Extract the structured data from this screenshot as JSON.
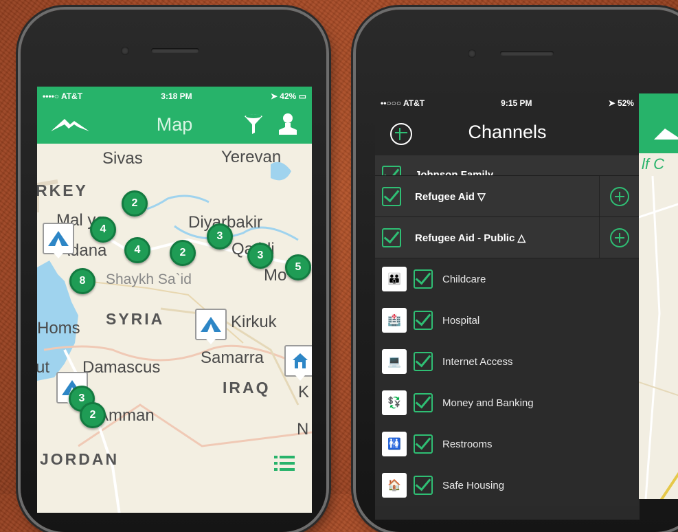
{
  "left_phone": {
    "status": {
      "carrier": "••••○ AT&T",
      "time": "3:18 PM",
      "battery": "42%"
    },
    "nav": {
      "title": "Map"
    },
    "map": {
      "labels": {
        "sivas": "Sivas",
        "yerevan": "Yerevan",
        "turkey": "RKEY",
        "malatya": "Mal   ya",
        "diyarbakir": "Diyarbakir",
        "adana": "Adana",
        "qamishli": "Qa   hli",
        "mosul": "Mo",
        "shaykh": "Shaykh Sa`id",
        "homs": "Homs",
        "syria": "SYRIA",
        "kirkuk": "Kirkuk",
        "samarra": "Samarra",
        "damascus": "Damascus",
        "iraq": "IRAQ",
        "k": "K",
        "amman": "Amman",
        "n": "N",
        "jordan": "JORDAN",
        "ut": "ut"
      },
      "clusters": [
        "2",
        "4",
        "4",
        "2",
        "3",
        "3",
        "5",
        "8",
        "3",
        "2"
      ]
    }
  },
  "right_phone": {
    "status": {
      "carrier": "••○○○ AT&T",
      "time": "9:15 PM",
      "battery": "52%"
    },
    "nav": {
      "title": "Channels"
    },
    "partial_channel": "Johnson Family",
    "channels": [
      {
        "name": "Refugee Aid",
        "arrow": "▽"
      },
      {
        "name": "Refugee Aid - Public",
        "arrow": "△"
      }
    ],
    "categories": [
      {
        "name": "Childcare",
        "icon": "childcare-icon",
        "glyph": "👪"
      },
      {
        "name": "Hospital",
        "icon": "hospital-icon",
        "glyph": "🏥"
      },
      {
        "name": "Internet Access",
        "icon": "internet-icon",
        "glyph": "💻"
      },
      {
        "name": "Money and Banking",
        "icon": "money-icon",
        "glyph": "💱"
      },
      {
        "name": "Restrooms",
        "icon": "restroom-icon",
        "glyph": "🚻"
      },
      {
        "name": "Safe Housing",
        "icon": "housing-icon",
        "glyph": "🏠"
      }
    ]
  },
  "peek": {
    "map_text": "lf C"
  },
  "colors": {
    "accent": "#27b36a",
    "cluster": "#1f9c55",
    "dark": "#2b2b2b",
    "background": "#a64a26"
  }
}
